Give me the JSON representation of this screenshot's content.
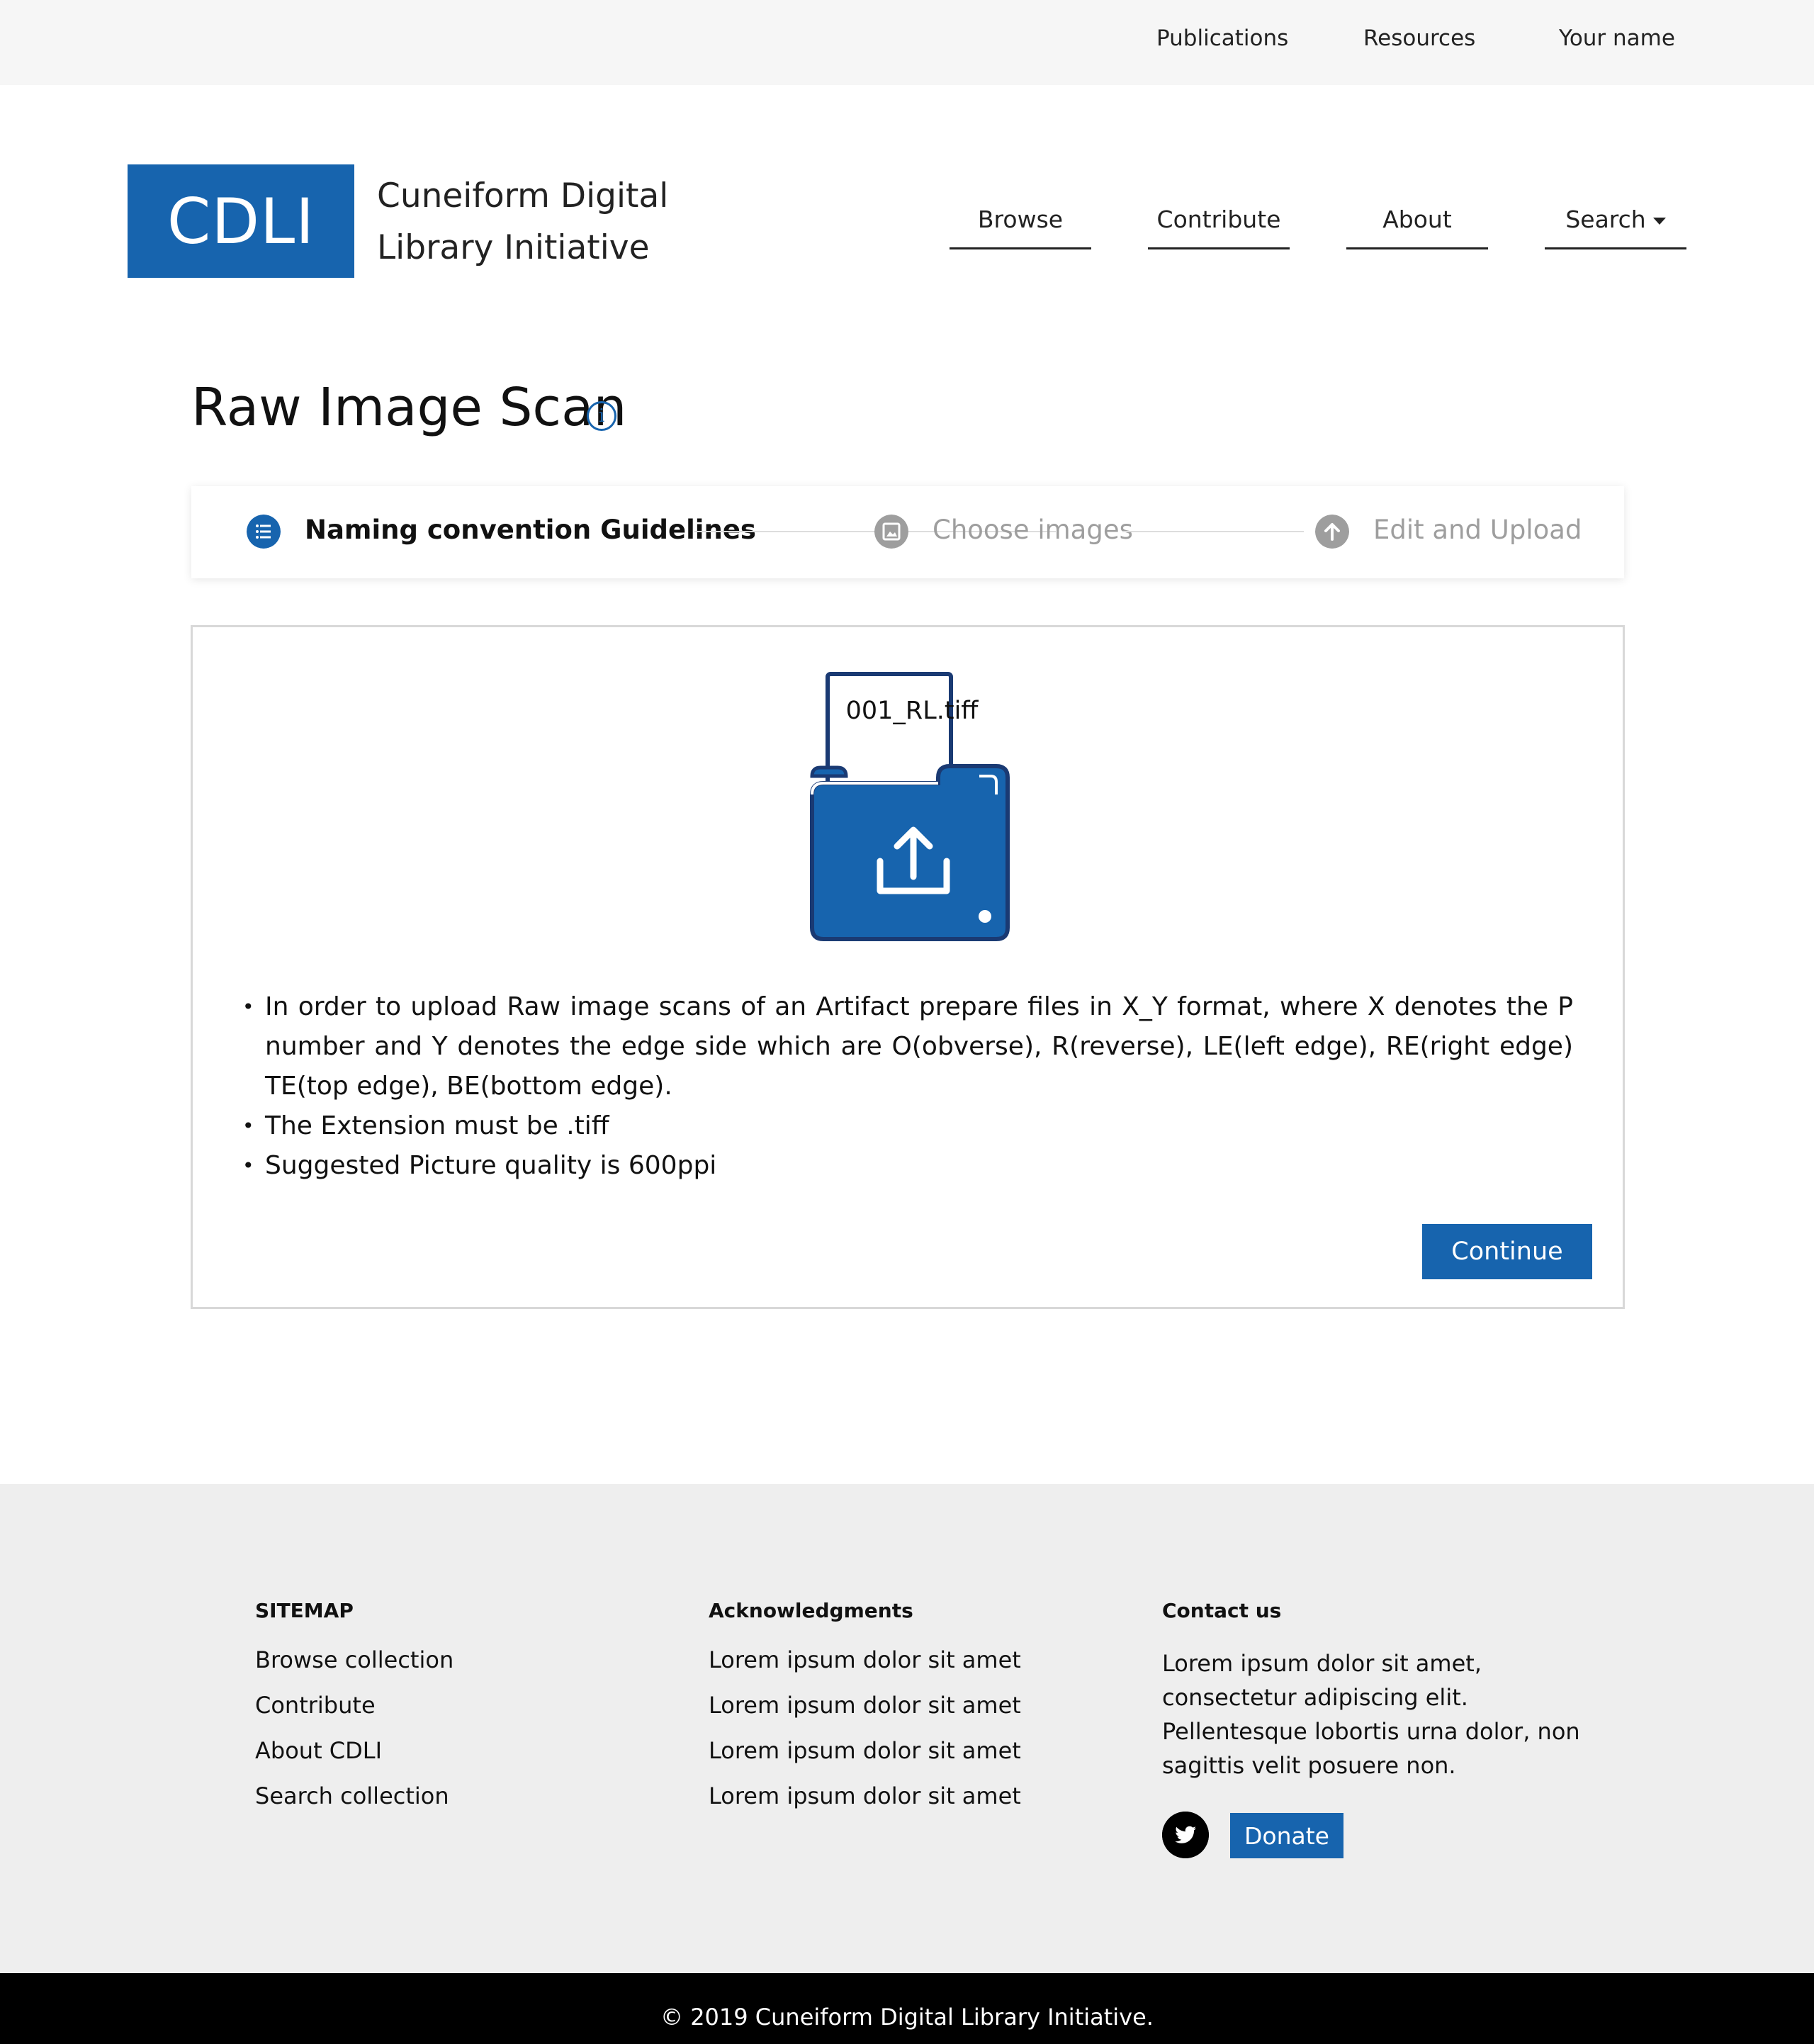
{
  "topbar": {
    "links": [
      "Publications",
      "Resources",
      "Your name"
    ]
  },
  "header": {
    "logo": "CDLI",
    "org_name_line1": "Cuneiform Digital",
    "org_name_line2": "Library Initiative",
    "nav": [
      "Browse",
      "Contribute",
      "About",
      "Search"
    ]
  },
  "page": {
    "title": "Raw Image Scan"
  },
  "stepper": {
    "steps": [
      {
        "label": "Naming convention Guidelines",
        "active": true
      },
      {
        "label": "Choose images",
        "active": false
      },
      {
        "label": "Edit and Upload",
        "active": false
      }
    ]
  },
  "card": {
    "file_name": "001_RL.tiff",
    "bullets": [
      "In order to upload Raw image scans of an Artifact prepare files in X_Y format, where X denotes the P number and Y denotes the edge side which are O(obverse), R(reverse), LE(left edge), RE(right edge) TE(top edge), BE(bottom edge).",
      "The Extension must be .tiff",
      "Suggested Picture quality is 600ppi"
    ],
    "continue_label": "Continue"
  },
  "footer": {
    "sitemap": {
      "heading": "SITEMAP",
      "items": [
        "Browse collection",
        "Contribute",
        "About CDLI",
        "Search collection"
      ]
    },
    "acknowledgments": {
      "heading": "Acknowledgments",
      "items": [
        "Lorem ipsum dolor sit amet",
        "Lorem ipsum dolor sit amet",
        "Lorem ipsum dolor sit amet",
        "Lorem ipsum dolor sit amet"
      ]
    },
    "contact": {
      "heading": "Contact us",
      "text": "Lorem ipsum dolor sit amet, consectetur adipiscing elit. Pellentesque lobortis urna dolor, non sagittis velit posuere non.",
      "donate_label": "Donate"
    },
    "copyright": "© 2019 Cuneiform Digital Library Initiative."
  },
  "colors": {
    "brand": "#1764ae",
    "inactive": "#9e9e9e",
    "footer_bg": "#eeeeee"
  },
  "icons": [
    "info-icon",
    "list-icon",
    "image-icon",
    "upload-arrow-icon",
    "folder-upload-icon",
    "twitter-icon",
    "caret-down-icon"
  ]
}
